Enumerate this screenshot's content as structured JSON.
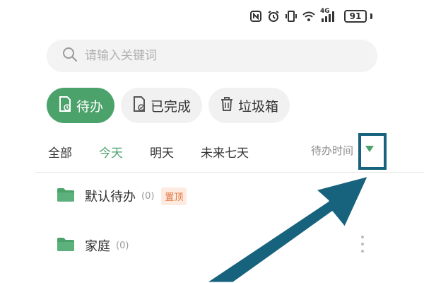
{
  "status_bar": {
    "network": "4G",
    "battery": "91",
    "icons": [
      "nfc-icon",
      "alarm-icon",
      "vibrate-icon",
      "wifi-icon",
      "signal-icon",
      "battery-icon"
    ]
  },
  "search": {
    "placeholder": "请输入关键词",
    "icon": "search-icon"
  },
  "chips": [
    {
      "label": "待办",
      "icon": "todo-doc-icon",
      "active": true
    },
    {
      "label": "已完成",
      "icon": "done-doc-icon",
      "active": false
    },
    {
      "label": "垃圾箱",
      "icon": "trash-icon",
      "active": false
    }
  ],
  "tabs": [
    {
      "label": "全部",
      "active": false
    },
    {
      "label": "今天",
      "active": true
    },
    {
      "label": "明天",
      "active": false
    },
    {
      "label": "未来七天",
      "active": false
    }
  ],
  "sort": {
    "label": "待办时间",
    "icon": "caret-down-icon"
  },
  "list": [
    {
      "name": "默认待办",
      "count": "(0)",
      "badge": "置顶",
      "icon": "folder-icon"
    },
    {
      "name": "家庭",
      "count": "(0)",
      "badge": "",
      "icon": "folder-icon"
    }
  ],
  "colors": {
    "accent": "#4ba26b",
    "annotation": "#17627d",
    "badge_bg": "#fdeae0",
    "badge_text": "#e0773f"
  }
}
